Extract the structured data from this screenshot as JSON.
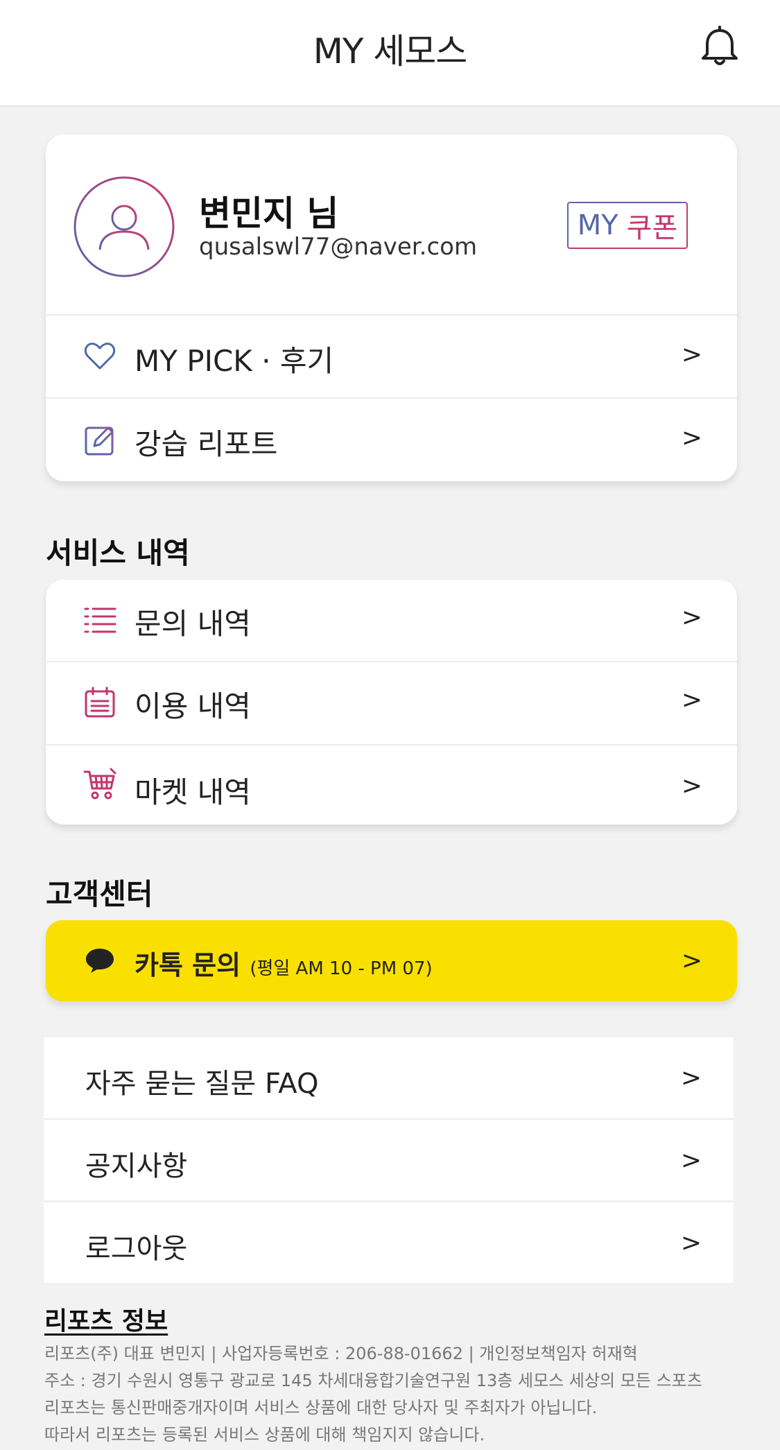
{
  "header": {
    "title": "MY 세모스"
  },
  "profile": {
    "name": "변민지 님",
    "email": "qusalswl77@naver.com",
    "coupon_my": "MY",
    "coupon_rest": "쿠폰"
  },
  "profile_menu": [
    {
      "label": "MY PICK · 후기",
      "icon": "heart-icon"
    },
    {
      "label": "강습 리포트",
      "icon": "edit-icon"
    }
  ],
  "service_section": {
    "title": "서비스 내역",
    "items": [
      {
        "label": "문의 내역",
        "icon": "list-icon"
      },
      {
        "label": "이용 내역",
        "icon": "calendar-icon"
      },
      {
        "label": "마켓 내역",
        "icon": "cart-icon"
      }
    ]
  },
  "support_section": {
    "title": "고객센터",
    "kakao_label": "카톡 문의",
    "kakao_hours": "(평일 AM 10 - PM 07)",
    "items": [
      {
        "label": "자주 묻는 질문 FAQ"
      },
      {
        "label": "공지사항"
      },
      {
        "label": "로그아웃"
      }
    ]
  },
  "arrow": ">",
  "footer": {
    "title": "리포츠 정보",
    "lines": [
      "리포츠(주) 대표 변민지 | 사업자등록번호 : 206-88-01662 | 개인정보책임자 허재혁",
      "주소 : 경기 수원시 영통구 광교로 145 차세대융합기술연구원 13층 세모스 세상의 모든 스포츠",
      "리포츠는 통신판매중개자이며 서비스 상품에 대한 당사자 및 주최자가 아닙니다.",
      "따라서 리포츠는 등록된 서비스 상품에 대해 책임지지 않습니다."
    ]
  },
  "colors": {
    "accent_blue": "#4e69ad",
    "accent_pink": "#c2366a",
    "kakao_yellow": "#f9e000",
    "background": "#f2f2f2"
  }
}
